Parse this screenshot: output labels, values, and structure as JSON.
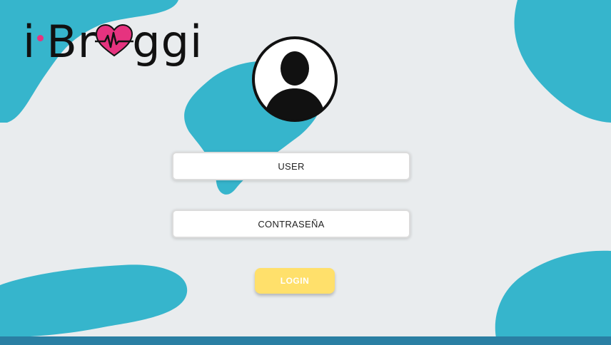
{
  "app": {
    "logo_text_prefix": "i",
    "logo_text_middle": "Br",
    "logo_text_suffix": "ggi"
  },
  "form": {
    "user_placeholder": "USER",
    "password_placeholder": "CONTRASEÑA",
    "login_label": "LOGIN"
  },
  "colors": {
    "background": "#e9ecee",
    "blob": "#36b5cc",
    "accent_pink": "#e6337f",
    "button_yellow": "#ffe06b",
    "bottom_bar": "#2a7fa3"
  },
  "icons": {
    "avatar": "user-silhouette-icon",
    "heart": "heart-pulse-icon"
  }
}
